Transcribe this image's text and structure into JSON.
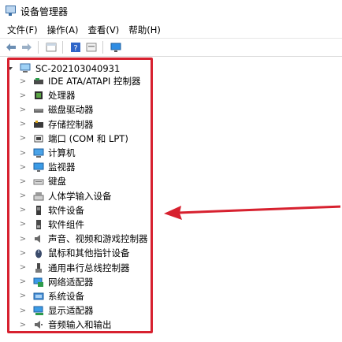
{
  "window": {
    "title": "设备管理器"
  },
  "menu": [
    {
      "label": "文件(F)"
    },
    {
      "label": "操作(A)"
    },
    {
      "label": "查看(V)"
    },
    {
      "label": "帮助(H)"
    }
  ],
  "toolbar": [
    {
      "icon": "back-arrow-icon"
    },
    {
      "icon": "forward-arrow-icon"
    },
    {
      "icon": "properties-icon"
    },
    {
      "icon": "help-icon"
    },
    {
      "icon": "console-icon"
    },
    {
      "icon": "monitor-icon"
    }
  ],
  "tree": {
    "root": {
      "label": "SC-202103040931",
      "expanded": true
    },
    "items": [
      {
        "label": "IDE ATA/ATAPI 控制器",
        "icon": "ide-controller-icon"
      },
      {
        "label": "处理器",
        "icon": "processor-icon"
      },
      {
        "label": "磁盘驱动器",
        "icon": "disk-drive-icon"
      },
      {
        "label": "存储控制器",
        "icon": "storage-controller-icon"
      },
      {
        "label": "端口 (COM 和 LPT)",
        "icon": "port-icon"
      },
      {
        "label": "计算机",
        "icon": "computer-icon"
      },
      {
        "label": "监视器",
        "icon": "monitor-icon"
      },
      {
        "label": "键盘",
        "icon": "keyboard-icon"
      },
      {
        "label": "人体学输入设备",
        "icon": "hid-icon"
      },
      {
        "label": "软件设备",
        "icon": "software-device-icon"
      },
      {
        "label": "软件组件",
        "icon": "software-component-icon"
      },
      {
        "label": "声音、视频和游戏控制器",
        "icon": "sound-icon"
      },
      {
        "label": "鼠标和其他指针设备",
        "icon": "mouse-icon"
      },
      {
        "label": "通用串行总线控制器",
        "icon": "usb-icon"
      },
      {
        "label": "网络适配器",
        "icon": "network-adapter-icon"
      },
      {
        "label": "系统设备",
        "icon": "system-device-icon"
      },
      {
        "label": "显示适配器",
        "icon": "display-adapter-icon"
      },
      {
        "label": "音频输入和输出",
        "icon": "audio-io-icon"
      }
    ]
  },
  "annotation": {
    "color": "#d7212f"
  }
}
